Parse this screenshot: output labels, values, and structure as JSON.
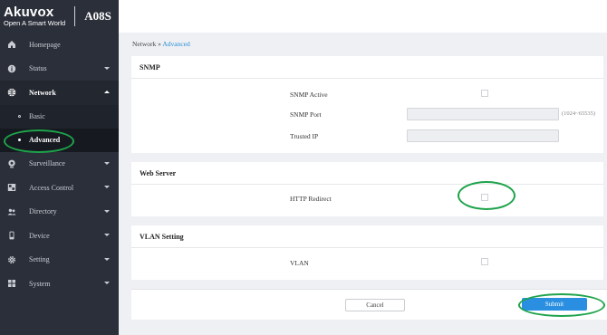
{
  "brand": {
    "name": "Akuvox",
    "tagline": "Open A Smart World",
    "model": "A08S"
  },
  "sidebar": {
    "items": [
      {
        "label": "Homepage",
        "icon": "home-icon"
      },
      {
        "label": "Status",
        "icon": "info-icon"
      },
      {
        "label": "Network",
        "icon": "network-icon"
      },
      {
        "label": "Surveillance",
        "icon": "camera-icon"
      },
      {
        "label": "Access Control",
        "icon": "access-control-icon"
      },
      {
        "label": "Directory",
        "icon": "users-icon"
      },
      {
        "label": "Device",
        "icon": "device-icon"
      },
      {
        "label": "Setting",
        "icon": "gear-icon"
      },
      {
        "label": "System",
        "icon": "system-icon"
      }
    ],
    "network_sub": [
      {
        "label": "Basic"
      },
      {
        "label": "Advanced"
      }
    ]
  },
  "breadcrumb": {
    "parent": "Network",
    "separator": "»",
    "current": "Advanced"
  },
  "snmp": {
    "title": "SNMP",
    "active_label": "SNMP Active",
    "port_label": "SNMP Port",
    "port_hint": "(1024~65535)",
    "trusted_ip_label": "Trusted IP"
  },
  "web_server": {
    "title": "Web Server",
    "http_redirect_label": "HTTP Redirect"
  },
  "vlan": {
    "title": "VLAN Setting",
    "vlan_label": "VLAN"
  },
  "actions": {
    "cancel": "Cancel",
    "submit": "Submit"
  },
  "colors": {
    "sidebar_bg": "#2b2f3a",
    "accent": "#2a8fe0",
    "highlight_ring": "#1ea34a"
  }
}
